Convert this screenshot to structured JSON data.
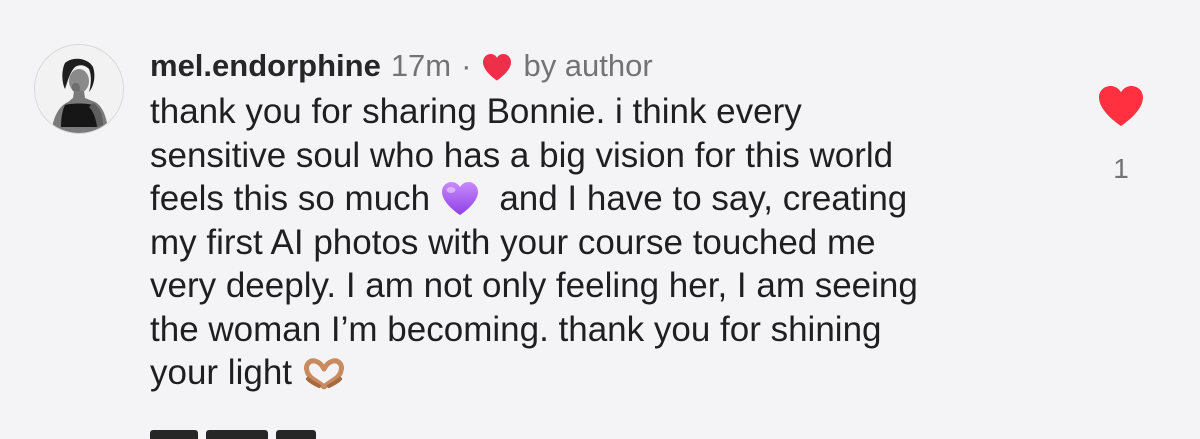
{
  "comment": {
    "username": "mel.endorphine",
    "time": "17m",
    "separator": "·",
    "author_badge": "by author",
    "body_lines": [
      "thank you for sharing Bonnie. i think every",
      "sensitive soul who has a big vision for this world",
      "feels this so much",
      "and I have to say, creating",
      "my first AI photos with your course touched me",
      "very deeply. I am not only feeling her, I am seeing",
      "the woman I’m becoming. thank you for shining",
      "your light"
    ],
    "like_count": "1"
  },
  "icons": {
    "avatar": "profile-photo",
    "author_heart": "heart-icon",
    "purple_heart": "purple-heart-emoji",
    "heart_hands": "heart-hands-emoji",
    "like": "heart-icon"
  },
  "colors": {
    "background": "#f4f4f6",
    "like_red": "#ff3040",
    "author_heart_red": "#ed2f4a",
    "purple_heart": "#a855f7",
    "secondary_text": "#737373",
    "primary_text": "#262626"
  }
}
